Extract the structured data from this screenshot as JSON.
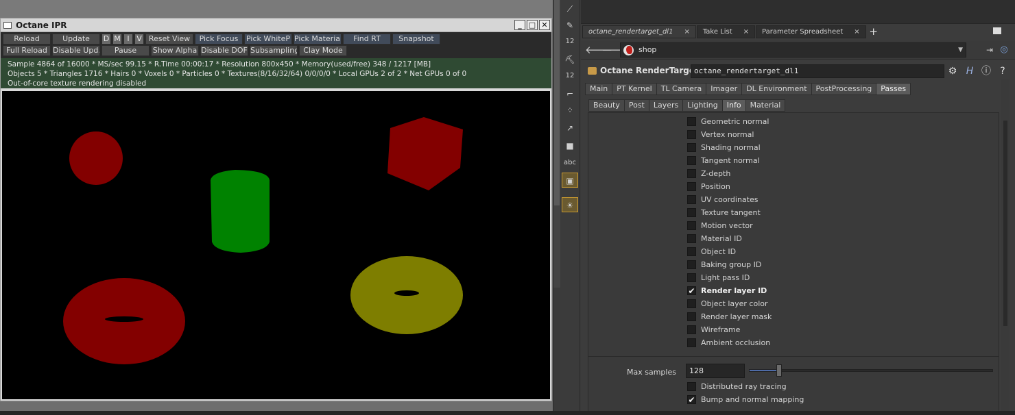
{
  "ipr": {
    "title": "Octane IPR",
    "window_buttons": [
      "_",
      "□",
      "✕"
    ],
    "toolbar_row1": [
      {
        "label": "Reload",
        "style": "normal"
      },
      {
        "label": "Update",
        "style": "normal"
      },
      {
        "label": "D",
        "style": "lite"
      },
      {
        "label": "M",
        "style": "lite"
      },
      {
        "label": "I",
        "style": "lite"
      },
      {
        "label": "V",
        "style": "lite"
      },
      {
        "label": "Reset View",
        "style": "normal"
      },
      {
        "label": "Pick Focus",
        "style": "blue"
      },
      {
        "label": "Pick WhiteP",
        "style": "blue"
      },
      {
        "label": "Pick Material",
        "style": "blue"
      },
      {
        "label": "Find RT",
        "style": "blue"
      },
      {
        "label": "Snapshot",
        "style": "blue"
      }
    ],
    "toolbar_row2": [
      {
        "label": "Full Reload",
        "style": "normal"
      },
      {
        "label": "Disable Upd.",
        "style": "normal"
      },
      {
        "label": "Pause",
        "style": "normal"
      },
      {
        "label": "Show Alpha",
        "style": "normal"
      },
      {
        "label": "Disable DOF",
        "style": "normal"
      },
      {
        "label": "Subsampling",
        "style": "normal"
      },
      {
        "label": "Clay Mode",
        "style": "normal"
      }
    ],
    "status_lines": [
      "Sample 4864 of 16000 * MS/sec 99.15 * R.Time 00:00:17 * Resolution 800x450 * Memory(used/free) 348 / 1217 [MB]",
      "Objects 5 * Triangles 1716 * Hairs 0 * Voxels 0 * Particles 0 * Textures(8/16/32/64) 0/0/0/0 * Local GPUs 2 of 2 * Net GPUs 0 of 0",
      "Out-of-core texture rendering disabled"
    ],
    "render_colors": {
      "red": "#830000",
      "green": "#008200",
      "yellow": "#7e7e00",
      "background": "#000000"
    }
  },
  "toolstrip": {
    "tools": [
      {
        "name": "brush-icon",
        "glyph": "⟋"
      },
      {
        "name": "pen-icon",
        "glyph": "✎"
      },
      {
        "name": "value-icon",
        "glyph": "12"
      },
      {
        "name": "paint-icon",
        "glyph": "⛏"
      },
      {
        "name": "value-icon-2",
        "glyph": "12"
      },
      {
        "name": "select-icon",
        "glyph": "⌐"
      },
      {
        "name": "grid-icon",
        "glyph": "⁘"
      },
      {
        "name": "transform-icon",
        "glyph": "↗"
      },
      {
        "name": "stop-icon",
        "glyph": "■"
      },
      {
        "name": "text-icon",
        "glyph": "abc"
      },
      {
        "name": "image-icon",
        "glyph": "▣"
      },
      {
        "name": "light-icon",
        "glyph": "☀"
      }
    ]
  },
  "panel": {
    "tabs": [
      {
        "label": "octane_rendertarget_dl1",
        "active": true
      },
      {
        "label": "Take List",
        "active": false
      },
      {
        "label": "Parameter Spreadsheet",
        "active": false
      }
    ],
    "tab_close": "×",
    "tab_add": "+",
    "back_arrow": "🡐",
    "forward_arrow": "🡒",
    "path": "shop",
    "path_dropdown": "▼",
    "node_type": "Octane RenderTarget",
    "node_name": "octane_rendertarget_dl1",
    "node_icons": [
      "⚙",
      "H",
      "ⓘ",
      "?"
    ],
    "main_tabs": [
      "Main",
      "PT Kernel",
      "TL Camera",
      "Imager",
      "DL Environment",
      "PostProcessing",
      "Passes"
    ],
    "main_tab_active": "Passes",
    "sub_tabs": [
      "Beauty",
      "Post",
      "Layers",
      "Lighting",
      "Info",
      "Material"
    ],
    "sub_tab_active": "Info",
    "passes": [
      {
        "label": "Geometric normal",
        "checked": false
      },
      {
        "label": "Vertex normal",
        "checked": false
      },
      {
        "label": "Shading normal",
        "checked": false
      },
      {
        "label": "Tangent normal",
        "checked": false
      },
      {
        "label": "Z-depth",
        "checked": false
      },
      {
        "label": "Position",
        "checked": false
      },
      {
        "label": "UV coordinates",
        "checked": false
      },
      {
        "label": "Texture tangent",
        "checked": false
      },
      {
        "label": "Motion vector",
        "checked": false
      },
      {
        "label": "Material ID",
        "checked": false
      },
      {
        "label": "Object ID",
        "checked": false
      },
      {
        "label": "Baking group ID",
        "checked": false
      },
      {
        "label": "Light pass ID",
        "checked": false
      },
      {
        "label": "Render layer ID",
        "checked": true
      },
      {
        "label": "Object layer color",
        "checked": false
      },
      {
        "label": "Render layer mask",
        "checked": false
      },
      {
        "label": "Wireframe",
        "checked": false
      },
      {
        "label": "Ambient occlusion",
        "checked": false
      }
    ],
    "max_samples": {
      "label": "Max samples",
      "value": "128",
      "slider_fraction": 0.12
    },
    "extra_options": [
      {
        "label": "Distributed ray tracing",
        "checked": false
      },
      {
        "label": "Bump and normal mapping",
        "checked": true
      }
    ],
    "check_glyph": "✔"
  }
}
